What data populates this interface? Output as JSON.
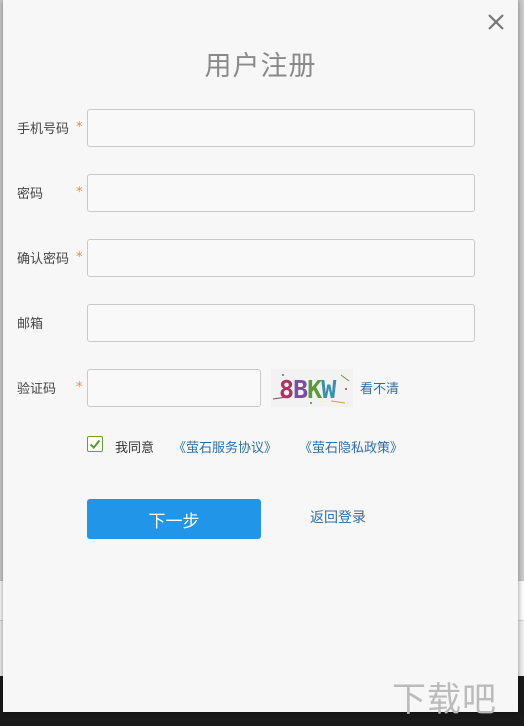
{
  "dialog": {
    "title": "用户注册",
    "close_icon": "close-icon"
  },
  "form": {
    "phone": {
      "label": "手机号码",
      "required": "*",
      "value": ""
    },
    "password": {
      "label": "密码",
      "required": "*",
      "value": ""
    },
    "confirm_password": {
      "label": "确认密码",
      "required": "*",
      "value": ""
    },
    "email": {
      "label": "邮箱",
      "value": ""
    },
    "captcha": {
      "label": "验证码",
      "required": "*",
      "value": "",
      "image_text": "8BKW",
      "refresh_label": "看不清"
    }
  },
  "agreement": {
    "checked": true,
    "prefix": "我同意",
    "service_link": "《萤石服务协议》",
    "privacy_link": "《萤石隐私政策》"
  },
  "actions": {
    "next_label": "下一步",
    "back_login_label": "返回登录"
  },
  "watermark": "下载吧",
  "colors": {
    "primary_button": "#2196e8",
    "link": "#2f6fa8",
    "required_star": "#f08a3c",
    "checkbox_check": "#5a9a2a"
  }
}
